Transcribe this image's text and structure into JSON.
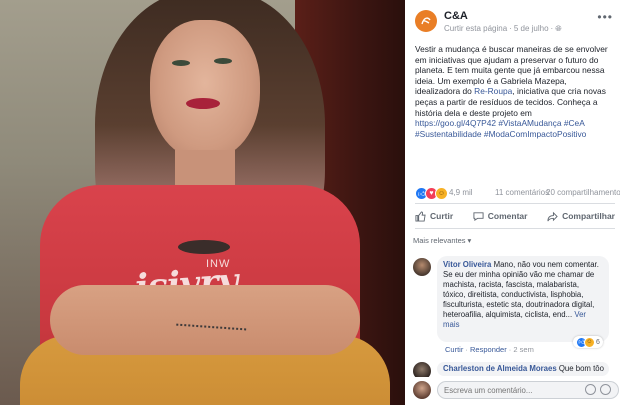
{
  "post": {
    "page_name": "C&A",
    "follow_label": "Curtir esta página",
    "date": "5 de julho",
    "more": "•••",
    "text_p1": "Vestir a mudança é buscar maneiras de se envolver em iniciativas que ajudam a preservar o futuro do planeta. E tem muita gente que já embarcou nessa ideia. Um exemplo é a Gabriela Mazepa, idealizadora do ",
    "text_link1": "Re-Roupa",
    "text_p2": ", iniciativa que cria novas peças a partir de resíduos de tecidos. Conheça a história dela e deste projeto em ",
    "text_url": "https://goo.gl/4Q7P42",
    "text_tags": " #VistaAMudança #CeA #Sustentabilidade #ModaComImpactoPositivo"
  },
  "stats": {
    "reactions": "4,9 mil",
    "comments": "11 comentários",
    "shares": "20 compartilhamentos"
  },
  "actions": {
    "like": "Curtir",
    "comment": "Comentar",
    "share": "Compartilhar"
  },
  "sort_label": "Mais relevantes",
  "comment1": {
    "author": "Vitor Oliveira",
    "text": " Mano, não vou nem comentar. Se eu der minha opinião vão me chamar de machista, racista, fascista, malabarista, tóxico, direitista, conductivista, lisphobia, fisculturista, estetic sta, doutrinadora digital, heteroafilia, alquimista, ciclista, end...",
    "see_more": "Ver mais",
    "reactions": "6",
    "like": "Curtir",
    "reply": "Responder",
    "time": "2 sem"
  },
  "comment2": {
    "author": "Charleston de Almeida Moraes",
    "text": " Que bom tôo"
  },
  "composer": {
    "placeholder": "Escreva um comentário..."
  },
  "photo": {
    "shirt_text": "isivry",
    "shirt_small": "INW"
  },
  "colors": {
    "link": "#385898",
    "brand": "#e97e26",
    "shirt": "#d9434c"
  }
}
